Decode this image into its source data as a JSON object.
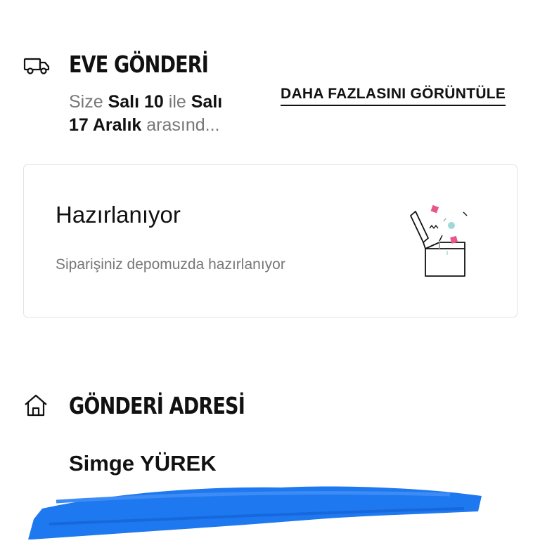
{
  "delivery": {
    "title": "EVE GÖNDERİ",
    "text_prefix": "Size ",
    "date_start": "Salı 10",
    "text_mid": " ile ",
    "date_end_part1": "Salı",
    "date_end_part2": "17 Aralık",
    "text_suffix": " arasınd...",
    "more_link": "DAHA FAZLASINI GÖRÜNTÜLE",
    "icon": "truck-icon"
  },
  "status": {
    "title": "Hazırlanıyor",
    "description": "Siparişiniz depomuzda hazırlanıyor",
    "illustration": "open-box-illustration",
    "accent_pink": "#e8578a",
    "accent_teal": "#9fd9d6"
  },
  "address": {
    "title": "GÖNDERİ ADRESİ",
    "icon": "home-icon",
    "name": "Simge YÜREK",
    "redaction_color": "#1e78f0"
  }
}
